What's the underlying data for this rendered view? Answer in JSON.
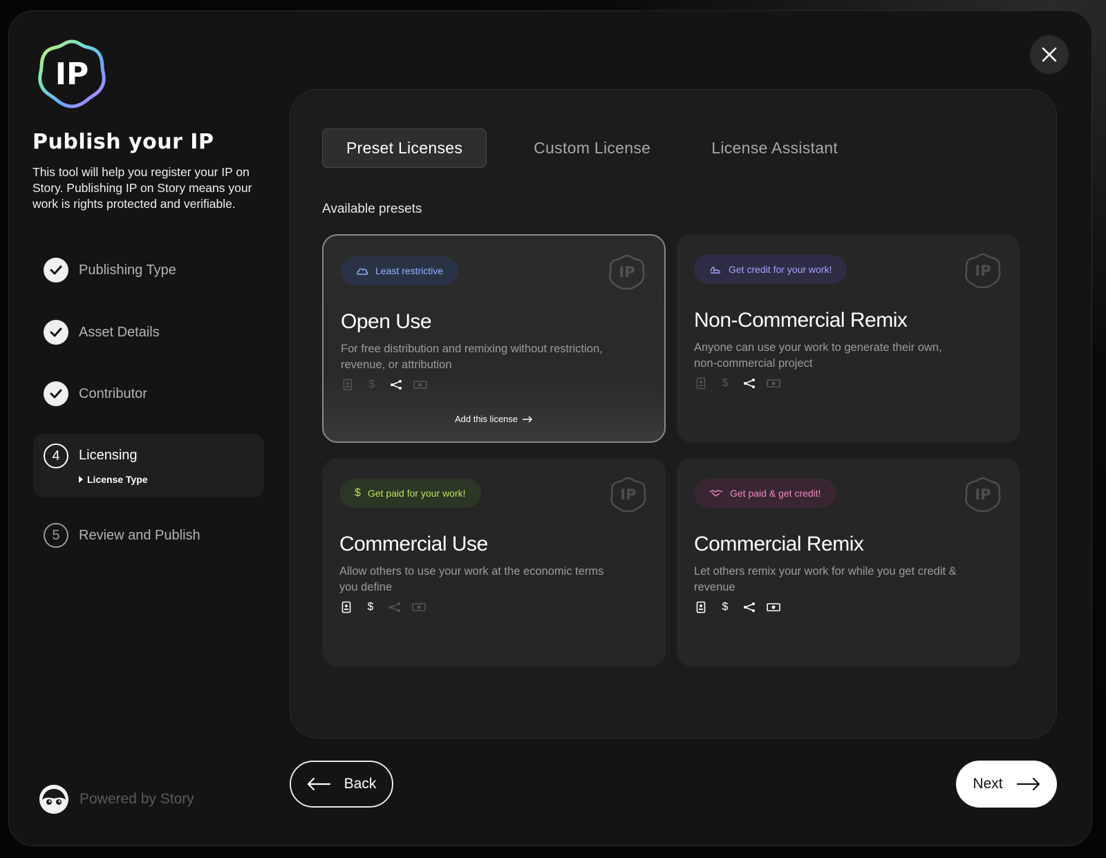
{
  "sidebar": {
    "title": "Publish your IP",
    "description": "This tool will help you register your IP on Story. Publishing IP on Story means your work is rights protected and verifiable.",
    "steps": [
      {
        "label": "Publishing Type",
        "status": "done"
      },
      {
        "label": "Asset Details",
        "status": "done"
      },
      {
        "label": "Contributor",
        "status": "done"
      },
      {
        "label": "Licensing",
        "number": "4",
        "status": "active",
        "substep": "License Type"
      },
      {
        "label": "Review and Publish",
        "number": "5",
        "status": "pending"
      }
    ],
    "powered_by": "Powered by Story",
    "logo_text": "IP"
  },
  "tabs": [
    "Preset Licenses",
    "Custom License",
    "License Assistant"
  ],
  "active_tab": "Preset Licenses",
  "presets_title": "Available presets",
  "cards": [
    {
      "badge": "Least restrictive",
      "badge_icon": "cloud-icon",
      "badge_color": "#8fb4ff",
      "badge_bg": "#2a3346",
      "title": "Open Use",
      "description": "For free distribution and remixing without restriction, revenue, or attribution",
      "icons_on": [
        false,
        false,
        true,
        false
      ],
      "selected": true,
      "cta": "Add this license"
    },
    {
      "badge": "Get credit for your work!",
      "badge_icon": "signature-icon",
      "badge_color": "#a7a4ff",
      "badge_bg": "#2e2d45",
      "title": "Non-Commercial Remix",
      "description": "Anyone can use your work to generate their own, non-commercial project",
      "icons_on": [
        false,
        false,
        true,
        false
      ],
      "selected": false
    },
    {
      "badge": "Get paid for your work!",
      "badge_icon": "dollar-icon",
      "badge_color": "#b6e35a",
      "badge_bg": "#2c3625",
      "title": "Commercial Use",
      "description": "Allow others to use your work at the economic terms you define",
      "icons_on": [
        true,
        true,
        false,
        false
      ],
      "selected": false
    },
    {
      "badge": "Get paid & get credit!",
      "badge_icon": "handshake-icon",
      "badge_color": "#f08ac4",
      "badge_bg": "#3a2633",
      "title": "Commercial Remix",
      "description": "Let others remix your work for while you get credit & revenue",
      "icons_on": [
        true,
        true,
        true,
        true
      ],
      "selected": false
    }
  ],
  "buttons": {
    "back": "Back",
    "next": "Next"
  }
}
